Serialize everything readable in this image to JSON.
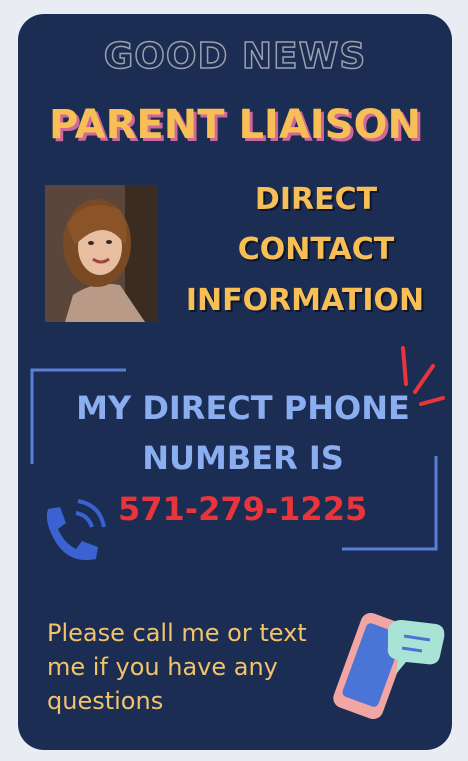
{
  "header": {
    "good_news": "GOOD NEWS",
    "title": "PARENT LIAISON"
  },
  "contact": {
    "line1": "DIRECT",
    "line2": "CONTACT",
    "line3": "INFORMATION"
  },
  "phone": {
    "label_line1": "MY DIRECT PHONE",
    "label_line2": "NUMBER IS",
    "number": "571-279-1225"
  },
  "message": {
    "line1": "Please call me or text",
    "line2": "me if you have any",
    "line3": "questions"
  },
  "colors": {
    "background": "#1b2d52",
    "accent_yellow": "#f7bf55",
    "phone_blue": "#8aaeef",
    "phone_red": "#e8353b",
    "frame_blue": "#5b7fd8"
  },
  "icons": {
    "photo": "profile-photo",
    "phone": "phone-icon",
    "spark": "spark-lines-icon",
    "device": "smartphone-chat-icon"
  }
}
